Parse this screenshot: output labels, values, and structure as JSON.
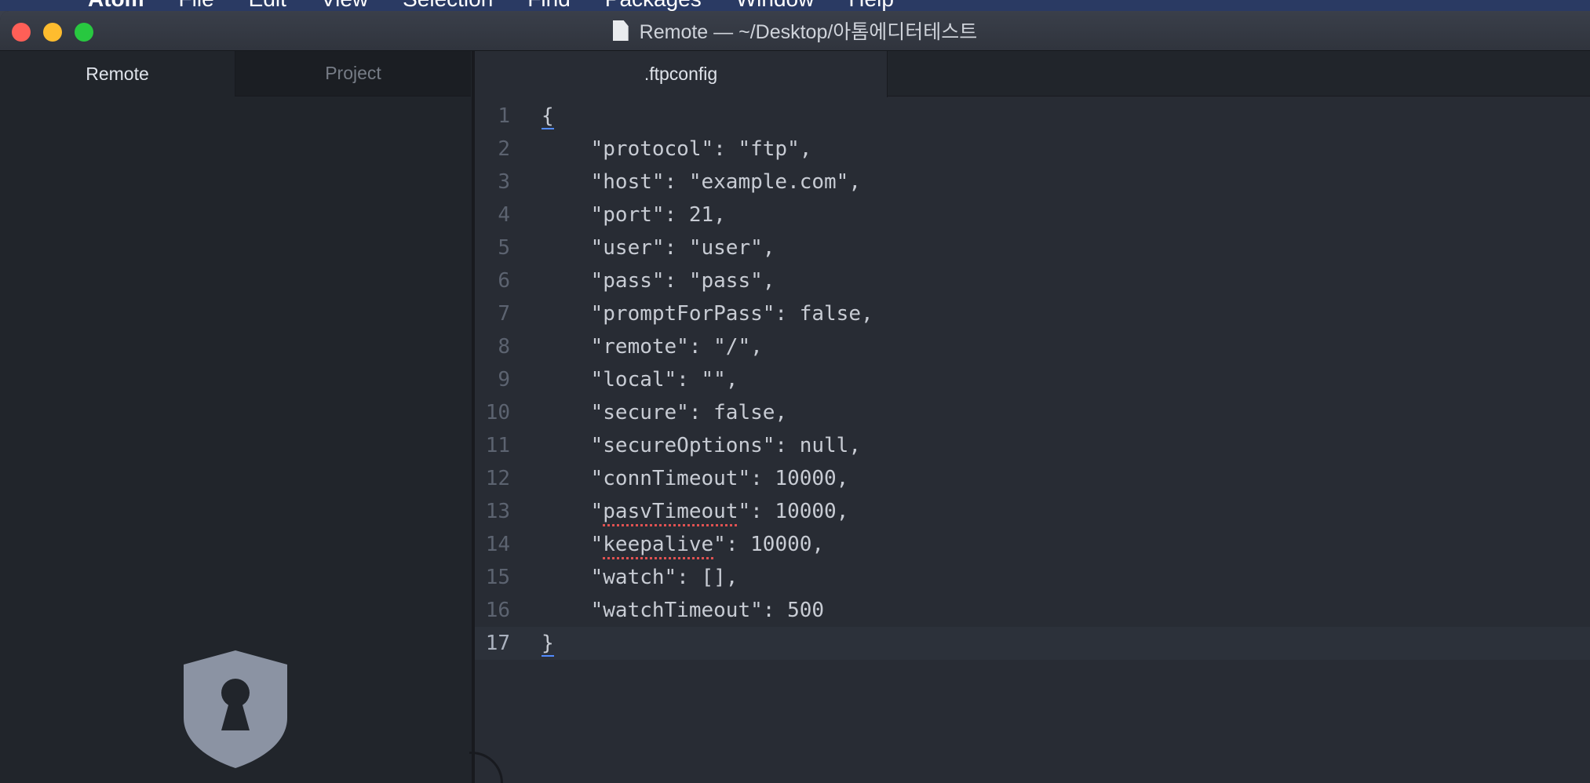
{
  "menubar": {
    "app_name": "Atom",
    "items": [
      "File",
      "Edit",
      "View",
      "Selection",
      "Find",
      "Packages",
      "Window",
      "Help"
    ]
  },
  "window": {
    "title": "Remote — ~/Desktop/아톰에디터테스트"
  },
  "left_dock": {
    "tabs": [
      {
        "label": "Remote",
        "active": true
      },
      {
        "label": "Project",
        "active": false
      }
    ],
    "icon": "shield-keyhole-icon"
  },
  "editor": {
    "tab_label": ".ftpconfig",
    "current_line": 17,
    "lines": [
      {
        "num": "1",
        "text": "{"
      },
      {
        "num": "2",
        "text": "    \"protocol\": \"ftp\","
      },
      {
        "num": "3",
        "text": "    \"host\": \"example.com\","
      },
      {
        "num": "4",
        "text": "    \"port\": 21,"
      },
      {
        "num": "5",
        "text": "    \"user\": \"user\","
      },
      {
        "num": "6",
        "text": "    \"pass\": \"pass\","
      },
      {
        "num": "7",
        "text": "    \"promptForPass\": false,"
      },
      {
        "num": "8",
        "text": "    \"remote\": \"/\","
      },
      {
        "num": "9",
        "text": "    \"local\": \"\","
      },
      {
        "num": "10",
        "text": "    \"secure\": false,"
      },
      {
        "num": "11",
        "text": "    \"secureOptions\": null,"
      },
      {
        "num": "12",
        "text": "    \"connTimeout\": 10000,"
      },
      {
        "num": "13",
        "text": "    \"pasvTimeout\": 10000,"
      },
      {
        "num": "14",
        "text": "    \"keepalive\": 10000,"
      },
      {
        "num": "15",
        "text": "    \"watch\": [],"
      },
      {
        "num": "16",
        "text": "    \"watchTimeout\": 500"
      },
      {
        "num": "17",
        "text": "}"
      }
    ]
  },
  "colors": {
    "editor_bg": "#282c34",
    "dock_bg": "#21252b",
    "text": "#c8ccd4",
    "gutter": "#5c6370",
    "cursor_accent": "#528bff",
    "spell_error": "#e05252"
  }
}
